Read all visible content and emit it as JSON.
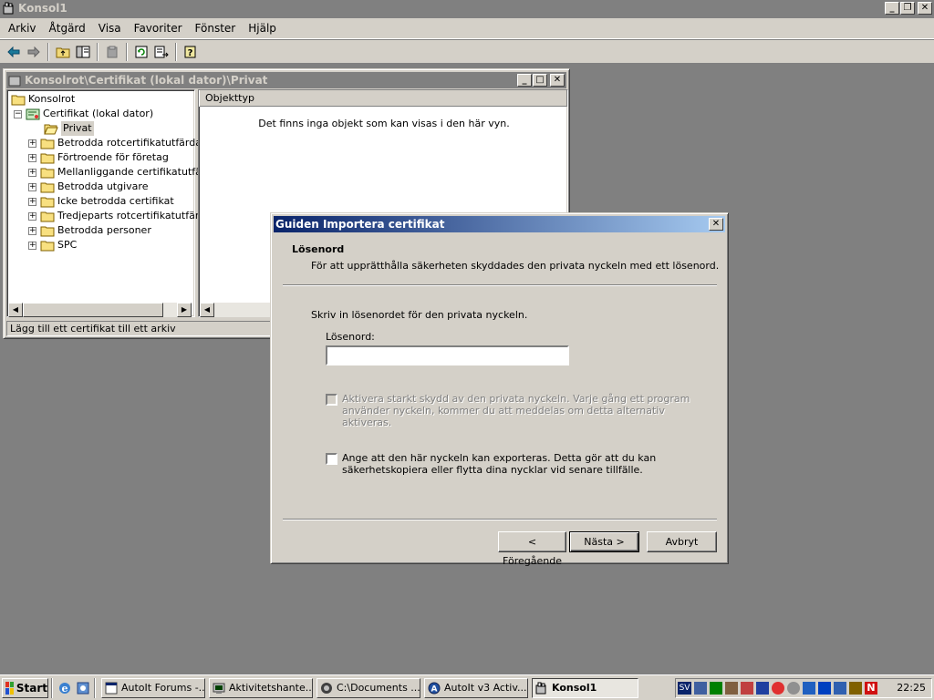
{
  "app": {
    "title": "Konsol1"
  },
  "menu": [
    "Arkiv",
    "Åtgärd",
    "Visa",
    "Favoriter",
    "Fönster",
    "Hjälp"
  ],
  "child_window": {
    "title": "Konsolrot\\Certifikat (lokal dator)\\Privat",
    "tree": {
      "root": "Konsolrot",
      "certs": "Certifikat (lokal dator)",
      "selected": "Privat",
      "items": [
        "Betrodda rotcertifikatutfärdare",
        "Förtroende för företag",
        "Mellanliggande certifikatutfärdare",
        "Betrodda utgivare",
        "Icke betrodda certifikat",
        "Tredjeparts rotcertifikatutfärdare",
        "Betrodda personer",
        "SPC"
      ]
    },
    "column_header": "Objekttyp",
    "empty_message": "Det finns inga objekt som kan visas i den här vyn.",
    "status": "Lägg till ett certifikat till ett arkiv"
  },
  "dialog": {
    "title": "Guiden Importera certifikat",
    "header_title": "Lösenord",
    "header_subtitle": "För att upprätthålla säkerheten skyddades den privata nyckeln med ett lösenord.",
    "instruction": "Skriv in lösenordet för den privata nyckeln.",
    "password_label": "Lösenord:",
    "password_value": "",
    "strong_protection_label": "Aktivera starkt skydd av den privata nyckeln. Varje gång ett program använder nyckeln, kommer du att meddelas om detta alternativ aktiveras.",
    "exportable_label": "Ange att den här nyckeln kan exporteras. Detta gör att du kan säkerhetskopiera eller flytta dina nycklar vid senare tillfälle.",
    "back_label": "< Föregående",
    "next_label": "Nästa >",
    "cancel_label": "Avbryt"
  },
  "taskbar": {
    "start_label": "Start",
    "tasks": [
      "AutoIt Forums -...",
      "Aktivitetshante...",
      "C:\\Documents ...",
      "AutoIt v3 Activ...",
      "Konsol1"
    ],
    "tray_lang": "SV",
    "clock": "22:25"
  },
  "colors": {
    "dialog_title_start": "#0a246a",
    "dialog_title_end": "#a6caf0",
    "inactive_title": "#808080",
    "face": "#d4d0c8"
  }
}
